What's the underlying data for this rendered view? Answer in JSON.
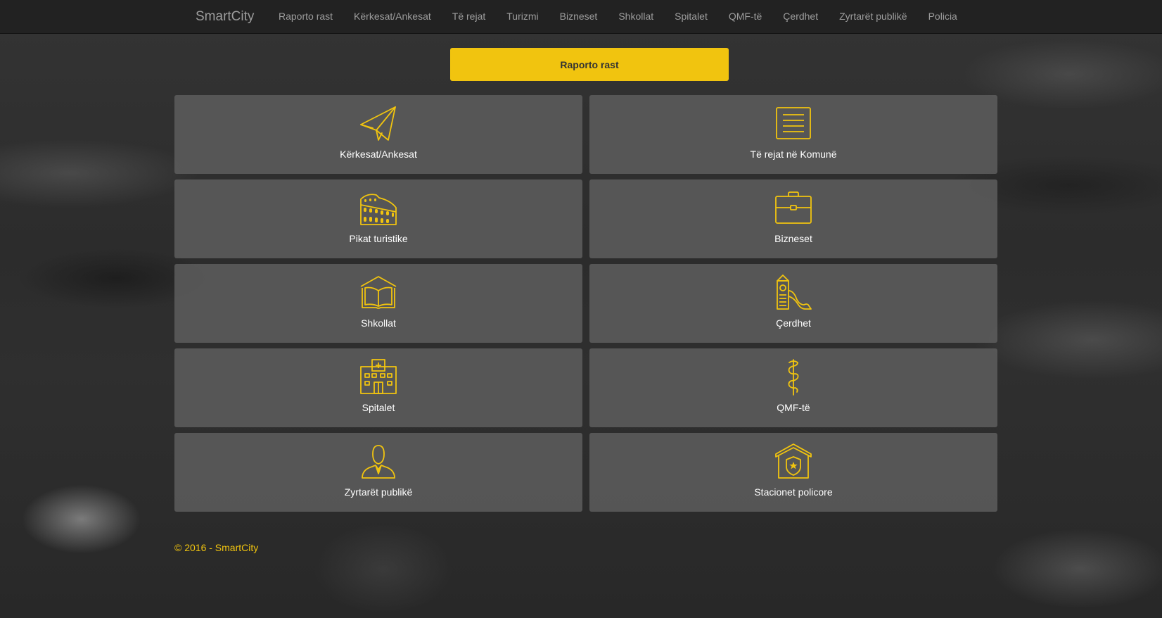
{
  "navbar": {
    "brand": "SmartCity",
    "links": [
      {
        "label": "Raporto rast"
      },
      {
        "label": "Kërkesat/Ankesat"
      },
      {
        "label": "Të rejat"
      },
      {
        "label": "Turizmi"
      },
      {
        "label": "Bizneset"
      },
      {
        "label": "Shkollat"
      },
      {
        "label": "Spitalet"
      },
      {
        "label": "QMF-të"
      },
      {
        "label": "Çerdhet"
      },
      {
        "label": "Zyrtarët publikë"
      },
      {
        "label": "Policia"
      }
    ]
  },
  "main": {
    "report_button": "Raporto rast",
    "tiles": [
      {
        "label": "Kërkesat/Ankesat",
        "icon": "paper-plane-icon"
      },
      {
        "label": "Të rejat në Komunë",
        "icon": "news-list-icon"
      },
      {
        "label": "Pikat turistike",
        "icon": "colosseum-icon"
      },
      {
        "label": "Bizneset",
        "icon": "briefcase-icon"
      },
      {
        "label": "Shkollat",
        "icon": "school-book-icon"
      },
      {
        "label": "Çerdhet",
        "icon": "playground-slide-icon"
      },
      {
        "label": "Spitalet",
        "icon": "hospital-icon"
      },
      {
        "label": "QMF-të",
        "icon": "caduceus-icon"
      },
      {
        "label": "Zyrtarët publikë",
        "icon": "official-person-icon"
      },
      {
        "label": "Stacionet policore",
        "icon": "police-station-icon"
      }
    ]
  },
  "footer": {
    "text": "© 2016 - SmartCity"
  },
  "colors": {
    "accent": "#f1c40f",
    "navbar_bg": "#222222",
    "nav_text": "#9d9d9d",
    "tile_bg": "#5f5f5f",
    "tile_text": "#ffffff"
  }
}
